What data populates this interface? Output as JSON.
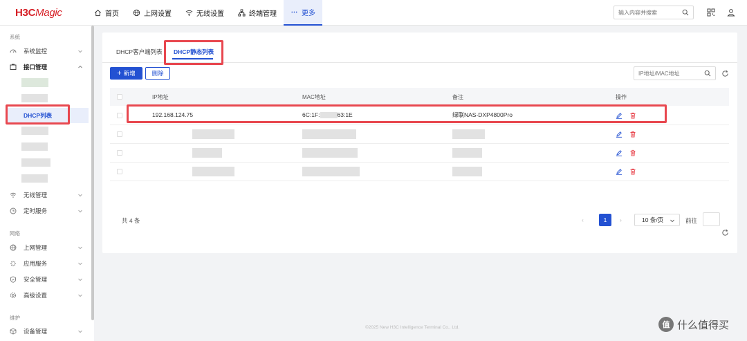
{
  "header": {
    "logo": {
      "mark": "H3C",
      "name": "Magic"
    },
    "nav": [
      {
        "label": "首页",
        "icon": "home-icon"
      },
      {
        "label": "上网设置",
        "icon": "globe-icon"
      },
      {
        "label": "无线设置",
        "icon": "wifi-icon"
      },
      {
        "label": "终端管理",
        "icon": "devices-icon"
      },
      {
        "label": "更多",
        "icon": "more-icon",
        "active": true
      }
    ],
    "search_placeholder": "输入内容并搜索"
  },
  "sidebar": {
    "sections": {
      "system": "系统",
      "network": "网络",
      "maintenance": "维护"
    },
    "items": {
      "monitor": "系统监控",
      "interface": "接口管理",
      "dhcp_list": "DHCP列表",
      "wireless": "无线管理",
      "schedule": "定时服务",
      "internet": "上网管理",
      "apps": "应用服务",
      "security": "安全管理",
      "advanced": "高级设置",
      "device": "设备管理"
    }
  },
  "content": {
    "tabs": [
      "DHCP客户端列表",
      "DHCP静态列表"
    ],
    "active_tab": 1,
    "add_label": "新增",
    "delete_label": "删除",
    "filter_placeholder": "IP地址/MAC地址",
    "table": {
      "headers": [
        "IP地址",
        "MAC地址",
        "备注",
        "操作"
      ],
      "rows": [
        {
          "ip": "192.168.124.75",
          "mac_prefix": "6C:1F:",
          "mac_suffix": "63:1E",
          "note": "绿联NAS-DXP4800Pro"
        }
      ]
    },
    "pagination": {
      "total": "共 4 条",
      "current_page": "1",
      "page_size": "10 条/页",
      "goto": "前往"
    }
  },
  "footer": "©2025 New H3C Intelligence Terminal Co., Ltd.",
  "watermark": {
    "badge": "值",
    "text": "什么值得买"
  },
  "colors": {
    "accent": "#2351d2",
    "highlight": "#e8474f",
    "brand_red": "#d61f26"
  }
}
